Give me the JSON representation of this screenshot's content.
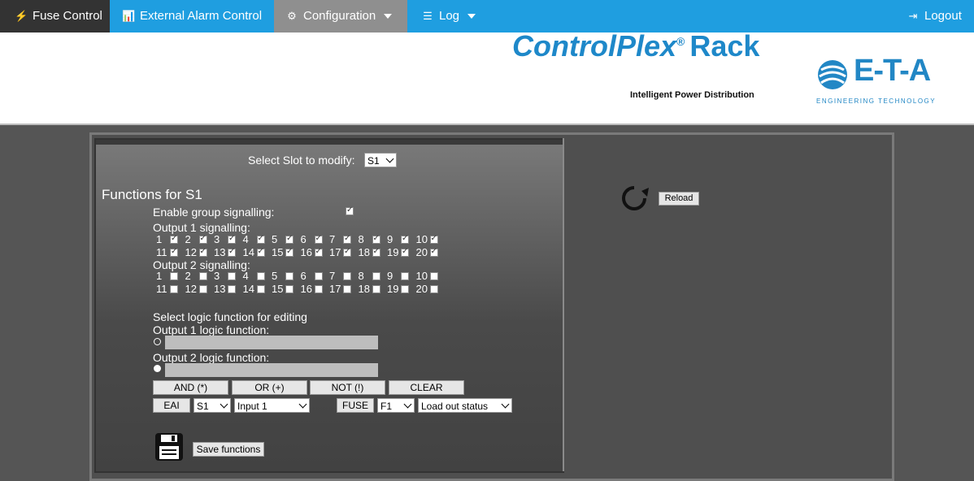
{
  "nav": {
    "fuse_control": "Fuse Control",
    "external_alarm": "External Alarm Control",
    "configuration": "Configuration",
    "log": "Log",
    "logout": "Logout"
  },
  "header": {
    "brand_control": "Control",
    "brand_plex": "Plex",
    "brand_reg": "®",
    "brand_rack": "Rack",
    "tagline": "Intelligent Power Distribution",
    "eta_logo": "E-T-A",
    "eta_sub": "ENGINEERING TECHNOLOGY"
  },
  "slot": {
    "label": "Select Slot to modify:",
    "value": "S1"
  },
  "functions": {
    "title": "Functions for S1",
    "enable_group": "Enable group signalling:",
    "output1_label": "Output 1 signalling:",
    "output2_label": "Output 2 signalling:",
    "output1_row1": [
      "1",
      "2",
      "3",
      "4",
      "5",
      "6",
      "7",
      "8",
      "9",
      "10"
    ],
    "output1_row2": [
      "11",
      "12",
      "13",
      "14",
      "15",
      "16",
      "17",
      "18",
      "19",
      "20"
    ],
    "output2_row1": [
      "1",
      "2",
      "3",
      "4",
      "5",
      "6",
      "7",
      "8",
      "9",
      "10"
    ],
    "output2_row2": [
      "11",
      "12",
      "13",
      "14",
      "15",
      "16",
      "17",
      "18",
      "19",
      "20"
    ]
  },
  "logic": {
    "select_label": "Select logic function for editing",
    "output1_label": "Output 1 logic function:",
    "output2_label": "Output 2 logic function:",
    "btn_and": "AND (*)",
    "btn_or": "OR (+)",
    "btn_not": "NOT (!)",
    "btn_clear": "CLEAR",
    "btn_eai": "EAI",
    "eai_slot": "S1",
    "eai_input": "Input 1",
    "btn_fuse": "FUSE",
    "fuse_slot": "F1",
    "fuse_status": "Load out status"
  },
  "save": {
    "label": "Save functions"
  },
  "reload": {
    "label": "Reload"
  }
}
